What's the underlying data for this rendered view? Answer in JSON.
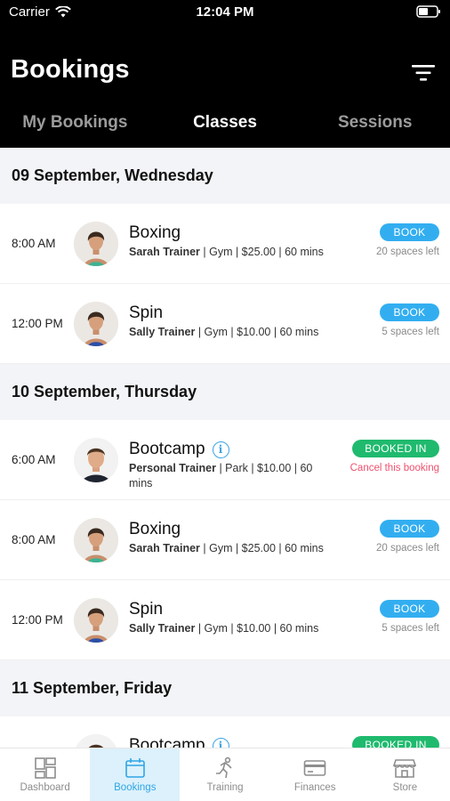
{
  "status_bar": {
    "carrier": "Carrier",
    "time": "12:04 PM"
  },
  "header": {
    "title": "Bookings",
    "filter_icon": "filter-icon"
  },
  "tabs": [
    {
      "label": "My Bookings",
      "active": false
    },
    {
      "label": "Classes",
      "active": true
    },
    {
      "label": "Sessions",
      "active": false
    }
  ],
  "days": [
    {
      "label": "09 September, Wednesday",
      "classes": [
        {
          "time": "8:00 AM",
          "name": "Boxing",
          "trainer": "Sarah Trainer",
          "details": " | Gym | $25.00 | 60 mins",
          "action": "BOOK",
          "note": "20 spaces left",
          "avatar": "woman-green"
        },
        {
          "time": "12:00 PM",
          "name": "Spin",
          "trainer": "Sally Trainer",
          "details": " | Gym | $10.00 | 60 mins",
          "action": "BOOK",
          "note": "5 spaces left",
          "avatar": "woman-blue"
        }
      ]
    },
    {
      "label": "10 September, Thursday",
      "classes": [
        {
          "time": "6:00 AM",
          "name": "Bootcamp",
          "info": true,
          "trainer": "Personal Trainer",
          "details": " | Park | $10.00 | 60 mins",
          "action": "BOOKED IN",
          "note": "Cancel this booking",
          "avatar": "man"
        },
        {
          "time": "8:00 AM",
          "name": "Boxing",
          "trainer": "Sarah Trainer",
          "details": " | Gym | $25.00 | 60 mins",
          "action": "BOOK",
          "note": "20 spaces left",
          "avatar": "woman-green"
        },
        {
          "time": "12:00 PM",
          "name": "Spin",
          "trainer": "Sally Trainer",
          "details": " | Gym | $10.00 | 60 mins",
          "action": "BOOK",
          "note": "5 spaces left",
          "avatar": "woman-blue"
        }
      ]
    },
    {
      "label": "11 September, Friday",
      "classes": [
        {
          "time": "",
          "name": "Bootcamp",
          "info": true,
          "trainer": "",
          "details": "",
          "action": "BOOKED IN",
          "note": "",
          "avatar": "man"
        }
      ]
    }
  ],
  "bottom_nav": [
    {
      "label": "Dashboard",
      "icon": "dashboard-icon",
      "active": false
    },
    {
      "label": "Bookings",
      "icon": "calendar-icon",
      "active": true
    },
    {
      "label": "Training",
      "icon": "running-icon",
      "active": false
    },
    {
      "label": "Finances",
      "icon": "card-icon",
      "active": false
    },
    {
      "label": "Store",
      "icon": "store-icon",
      "active": false
    }
  ],
  "colors": {
    "header_bg": "#000000",
    "book_blue": "#32aef0",
    "booked_green": "#1fba6e",
    "cancel_pink": "#f0506e",
    "day_header_bg": "#f3f4f7",
    "active_nav_bg": "#dcf1fb"
  }
}
